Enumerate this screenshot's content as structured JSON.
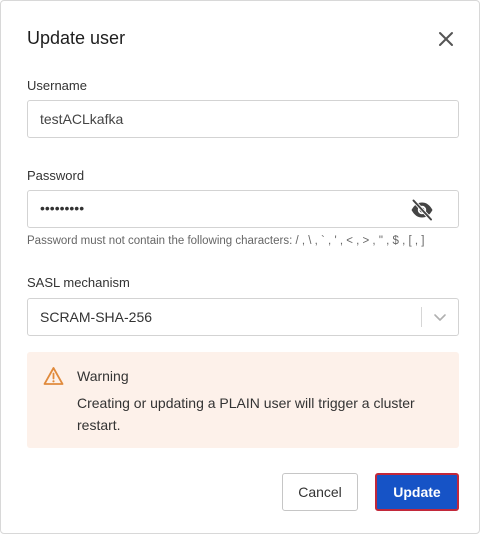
{
  "dialog": {
    "title": "Update user",
    "close_icon": "close-icon"
  },
  "username": {
    "label": "Username",
    "value": "testACLkafka"
  },
  "password": {
    "label": "Password",
    "value_masked": "•••••••••",
    "visibility_icon": "eye-off-icon",
    "hint": "Password must not contain the following characters: / , \\ , ` , ' , < , > , \" , $ , [ , ]"
  },
  "sasl": {
    "label": "SASL mechanism",
    "selected": "SCRAM-SHA-256",
    "dropdown_icon": "chevron-down-icon"
  },
  "warning": {
    "icon": "warning-icon",
    "title": "Warning",
    "message": "Creating or updating a PLAIN user will trigger a cluster restart."
  },
  "actions": {
    "cancel_label": "Cancel",
    "update_label": "Update"
  },
  "colors": {
    "primary": "#1653c6",
    "focus_outline": "#c2283a",
    "warning_bg": "#fdf1ea",
    "warning_icon": "#e08a3c"
  }
}
